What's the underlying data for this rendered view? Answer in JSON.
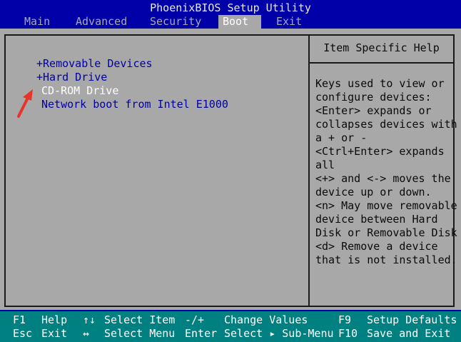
{
  "app": {
    "title": "PhoenixBIOS Setup Utility"
  },
  "menu": [
    {
      "label": "Main"
    },
    {
      "label": "Advanced"
    },
    {
      "label": "Security"
    },
    {
      "label": "Boot"
    },
    {
      "label": "Exit"
    }
  ],
  "active_tab": "Boot",
  "boot_items": [
    {
      "label": "+Removable Devices"
    },
    {
      "label": "+Hard Drive"
    },
    {
      "label": "CD-ROM Drive"
    },
    {
      "label": "Network boot from Intel E1000"
    }
  ],
  "selected_item": "CD-ROM Drive",
  "help": {
    "title": "Item Specific Help",
    "lines": [
      "Keys used to view or",
      "configure devices:",
      "<Enter> expands or",
      "collapses devices with",
      "a + or -",
      "<Ctrl+Enter> expands",
      "all",
      "<+> and <-> moves the",
      "device up or down.",
      "<n> May move removable",
      "device between Hard",
      "Disk or Removable Disk",
      "<d> Remove a device",
      "that is not installed."
    ]
  },
  "footer": {
    "row1": [
      {
        "key": "F1",
        "label": "Help"
      },
      {
        "key": "↑↓",
        "label": "Select Item"
      },
      {
        "key": "-/+",
        "label": "Change Values"
      },
      {
        "key": "F9",
        "label": "Setup Defaults"
      }
    ],
    "row2": [
      {
        "key": "Esc",
        "label": "Exit"
      },
      {
        "key": "↔",
        "label": "Select Menu"
      },
      {
        "key": "Enter",
        "label": "Select ▸ Sub-Menu"
      },
      {
        "key": "F10",
        "label": "Save and Exit"
      }
    ]
  },
  "colors": {
    "bios_blue": "#0000a8",
    "panel_gray": "#a8a8a8",
    "footer_teal": "#008080",
    "arrow_red": "#e8332a"
  },
  "icons": {
    "pointer": "red-arrow-icon"
  }
}
